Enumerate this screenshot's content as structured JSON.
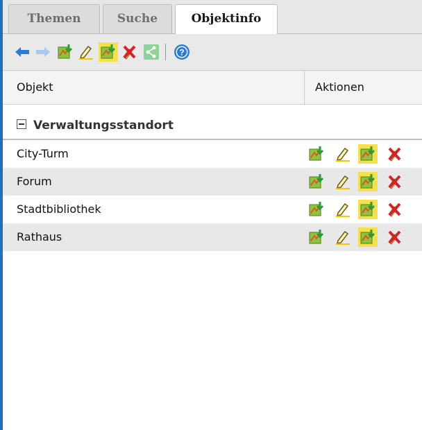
{
  "tabs": [
    "Themen",
    "Suche",
    "Objektinfo"
  ],
  "active_tab": "Objektinfo",
  "toolbar": {
    "icons": [
      "back-arrow-icon",
      "forward-arrow-icon",
      "map-export-icon",
      "pencil-edit-icon",
      "map-export-highlight-icon",
      "delete-icon",
      "share-icon",
      "help-icon"
    ]
  },
  "grid": {
    "columns": [
      "Objekt",
      "Aktionen"
    ],
    "group_title": "Verwaltungsstandort",
    "rows": [
      {
        "name": "City-Turm"
      },
      {
        "name": "Forum"
      },
      {
        "name": "Stadtbibliothek"
      },
      {
        "name": "Rathaus"
      }
    ],
    "row_actions": [
      "map-export-icon",
      "pencil-edit-icon",
      "map-export-highlight-icon",
      "delete-icon"
    ]
  },
  "colors": {
    "accent_border": "#1f6fba",
    "arrow_blue": "#2b7bd6",
    "highlight_yellow": "#f4e04c",
    "delete_red": "#d3222a"
  }
}
